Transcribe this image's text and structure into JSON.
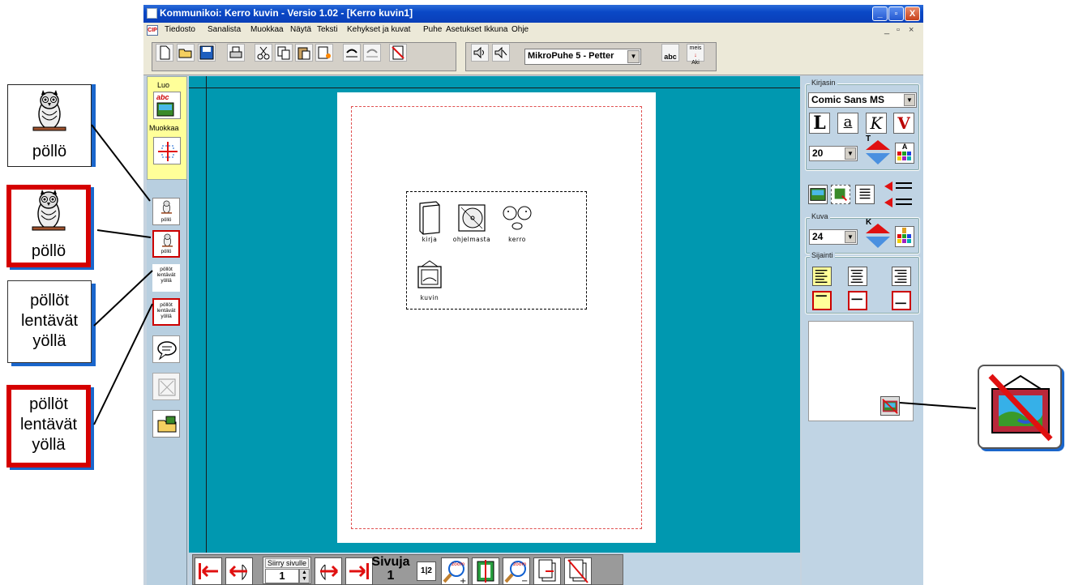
{
  "window": {
    "title": "Kommunikoi: Kerro kuvin - Versio 1.02 - [Kerro kuvin1]",
    "controls": [
      "_",
      "▫",
      "X"
    ]
  },
  "menu": [
    "Tiedosto",
    "Sanalista",
    "Muokkaa",
    "Näytä",
    "Teksti",
    "Kehykset ja kuvat",
    "Puhe",
    "Asetukset",
    "Ikkuna",
    "Ohje"
  ],
  "mdi_icon_text": "CIP",
  "toolbar": {
    "voice": "MikroPuhe 5 - Petter",
    "icons": [
      "new-document-icon",
      "open-folder-icon",
      "save-icon",
      "print-icon",
      "cut-icon",
      "copy-icon",
      "paste-icon",
      "paste-special-icon",
      "undo-icon",
      "redo-icon",
      "delete-page-icon",
      "speaker-icon",
      "speaker-stop-icon",
      "spellcheck-icon",
      "meis-aki-icon"
    ],
    "spell_label": "abc",
    "meis_label": "meis",
    "aki_label": "Aki"
  },
  "left_panel": {
    "luo_label": "Luo",
    "muokkaa_label": "Muokkaa",
    "abc_label": "abc",
    "owl_caption": "pöllö",
    "text_button": [
      "pöllöt",
      "lentävät",
      "yöllä"
    ]
  },
  "document": {
    "symbols": [
      {
        "label": "kirja",
        "icon": "book-icon"
      },
      {
        "label": "ohjelmasta",
        "icon": "cd-icon"
      },
      {
        "label": "kerro",
        "icon": "talk-icon"
      },
      {
        "label": "kuvin",
        "icon": "picture-icon"
      }
    ]
  },
  "right_panel": {
    "kirjasin_label": "Kirjasin",
    "font_name": "Comic Sans MS",
    "font_size": "20",
    "style_buttons": [
      "L",
      "a",
      "K",
      "V"
    ],
    "kuva_label": "Kuva",
    "image_size": "24",
    "sijainti_label": "Sijainti",
    "size_up_letter_t": "T",
    "size_up_letter_k": "K",
    "color_letter": "A"
  },
  "bottom_nav": {
    "siirry_label": "Siirry sivulle",
    "page_value": "1",
    "sivuja_label": "Sivuja",
    "sivuja_value": "1",
    "two_pages": "1|2",
    "zoom_label": "zoom"
  },
  "callouts": {
    "owl_caption": "pöllö",
    "text_lines": [
      "pöllöt",
      "lentävät",
      "yöllä"
    ]
  },
  "colors": {
    "title_blue": "#0a48c6",
    "doc_background": "#0098b0",
    "panel_blue": "#c0d4e4",
    "luo_yellow": "#ffff99",
    "accent_red": "#d50000",
    "arrow_red": "#e01010"
  }
}
